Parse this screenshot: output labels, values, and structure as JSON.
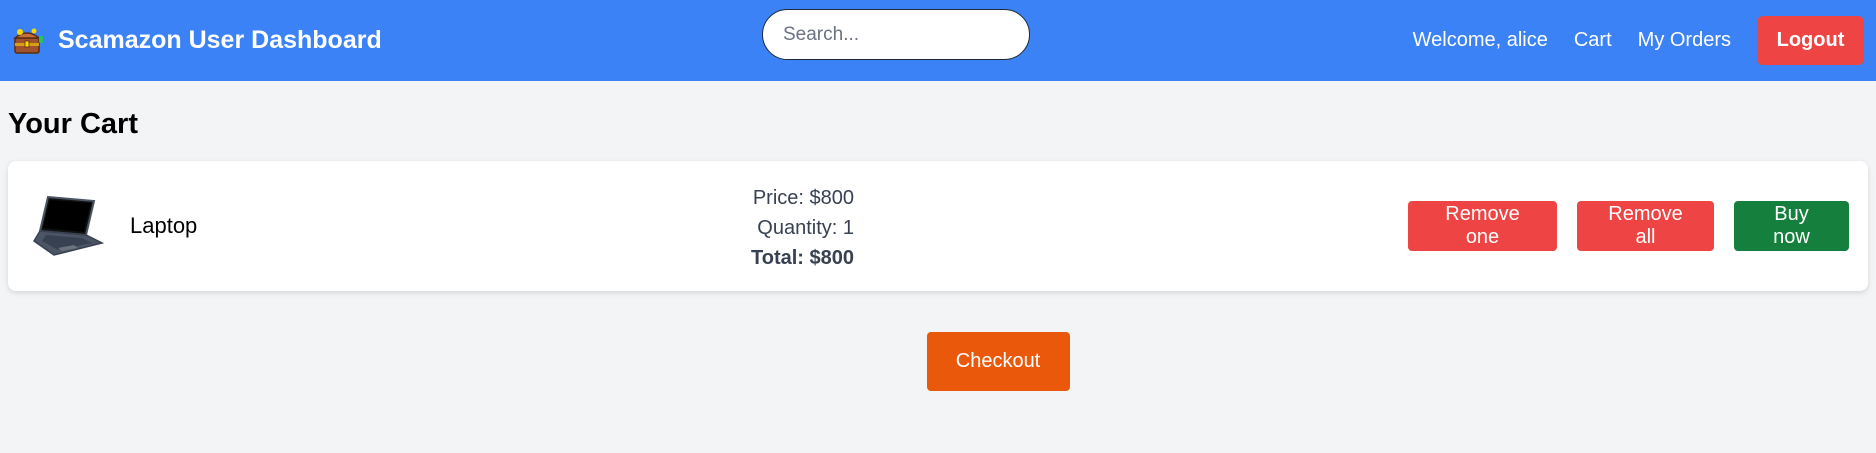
{
  "header": {
    "app_title": "Scamazon User Dashboard",
    "logo_icon": "treasure-chest-logo-icon",
    "search": {
      "placeholder": "Search...",
      "value": ""
    },
    "welcome_text": "Welcome, alice",
    "nav": {
      "cart": "Cart",
      "my_orders": "My Orders"
    },
    "logout_label": "Logout"
  },
  "main": {
    "title": "Your Cart",
    "cart_items": [
      {
        "name": "Laptop",
        "image_icon": "laptop-icon",
        "price": "Price: $800",
        "quantity": "Quantity: 1",
        "total": "Total: $800",
        "actions": {
          "remove_one": "Remove one",
          "remove_all": "Remove all",
          "buy_now": "Buy now"
        }
      }
    ],
    "checkout_label": "Checkout"
  },
  "colors": {
    "header_bg": "#3b82f6",
    "danger": "#ef4444",
    "success": "#15803d",
    "checkout": "#ea580c",
    "page_bg": "#f3f4f6"
  }
}
